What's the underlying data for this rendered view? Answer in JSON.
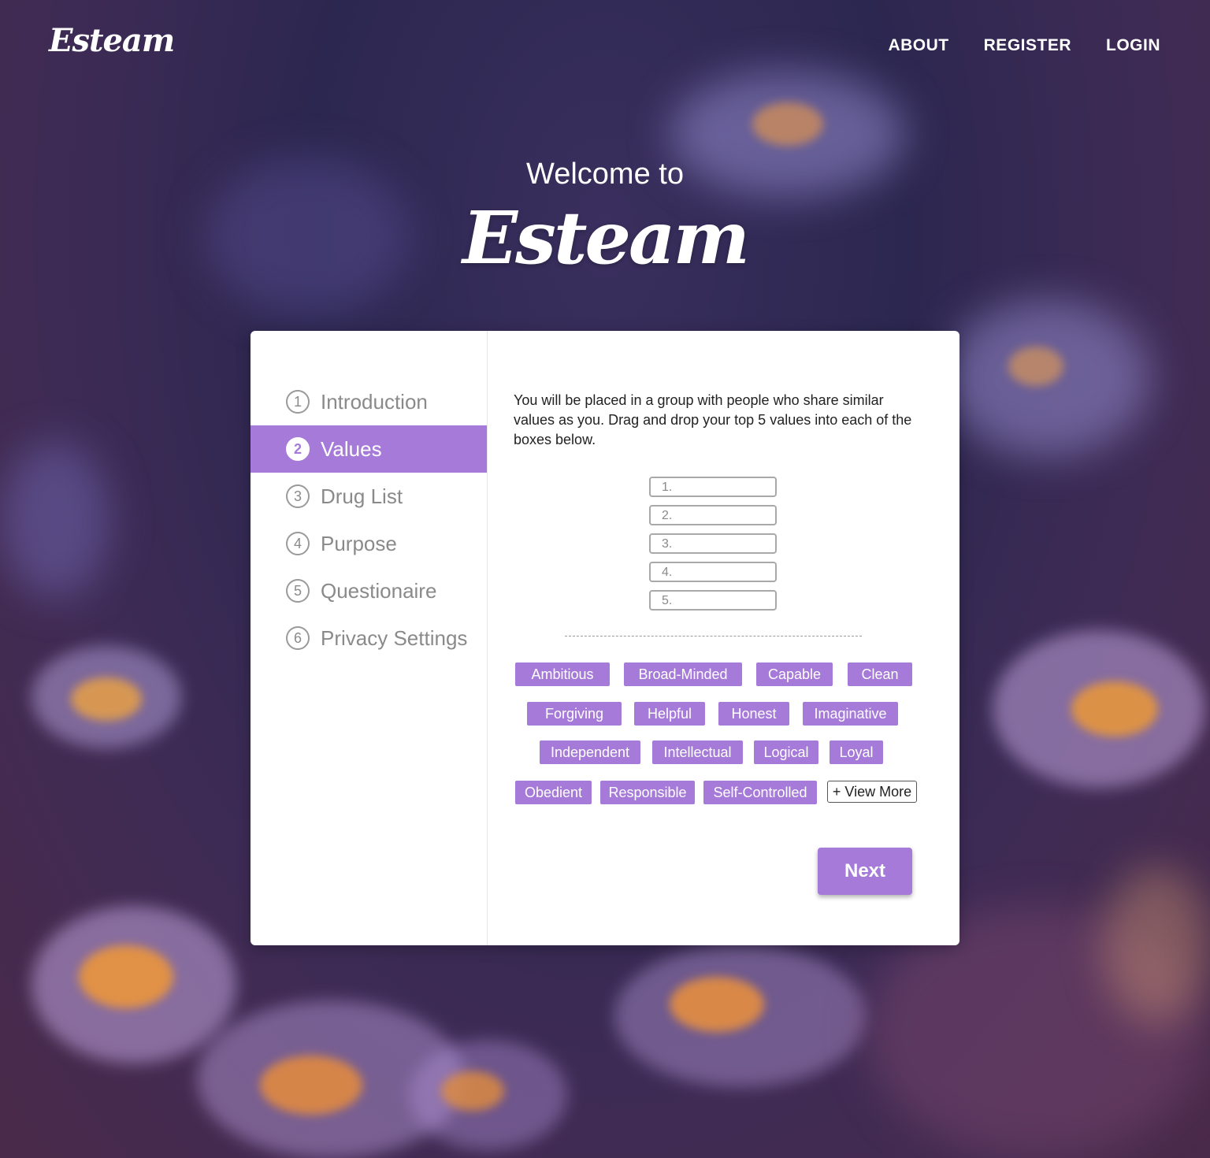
{
  "brand": {
    "logo": "Esteam"
  },
  "nav": {
    "links": [
      "ABOUT",
      "REGISTER",
      "LOGIN"
    ]
  },
  "hero": {
    "subtitle": "Welcome to",
    "title": "Esteam"
  },
  "steps": [
    {
      "number": "1",
      "label": "Introduction",
      "active": false
    },
    {
      "number": "2",
      "label": "Values",
      "active": true
    },
    {
      "number": "3",
      "label": "Drug List",
      "active": false
    },
    {
      "number": "4",
      "label": "Purpose",
      "active": false
    },
    {
      "number": "5",
      "label": "Questionaire",
      "active": false
    },
    {
      "number": "6",
      "label": "Privacy Settings",
      "active": false
    }
  ],
  "values_step": {
    "instructions": "You will be placed in a group with people who share similar values as you. Drag and drop your top 5 values into each of the boxes below.",
    "slots": [
      "1.",
      "2.",
      "3.",
      "4.",
      "5."
    ],
    "values": [
      "Ambitious",
      "Broad-Minded",
      "Capable",
      "Clean",
      "Forgiving",
      "Helpful",
      "Honest",
      "Imaginative",
      "Independent",
      "Intellectual",
      "Logical",
      "Loyal",
      "Obedient",
      "Responsible",
      "Self-Controlled"
    ],
    "view_more_label": "+ View More",
    "next_label": "Next"
  },
  "colors": {
    "accent": "#a57ad8",
    "card": "#ffffff",
    "inactive_text": "#8a8a8a"
  }
}
